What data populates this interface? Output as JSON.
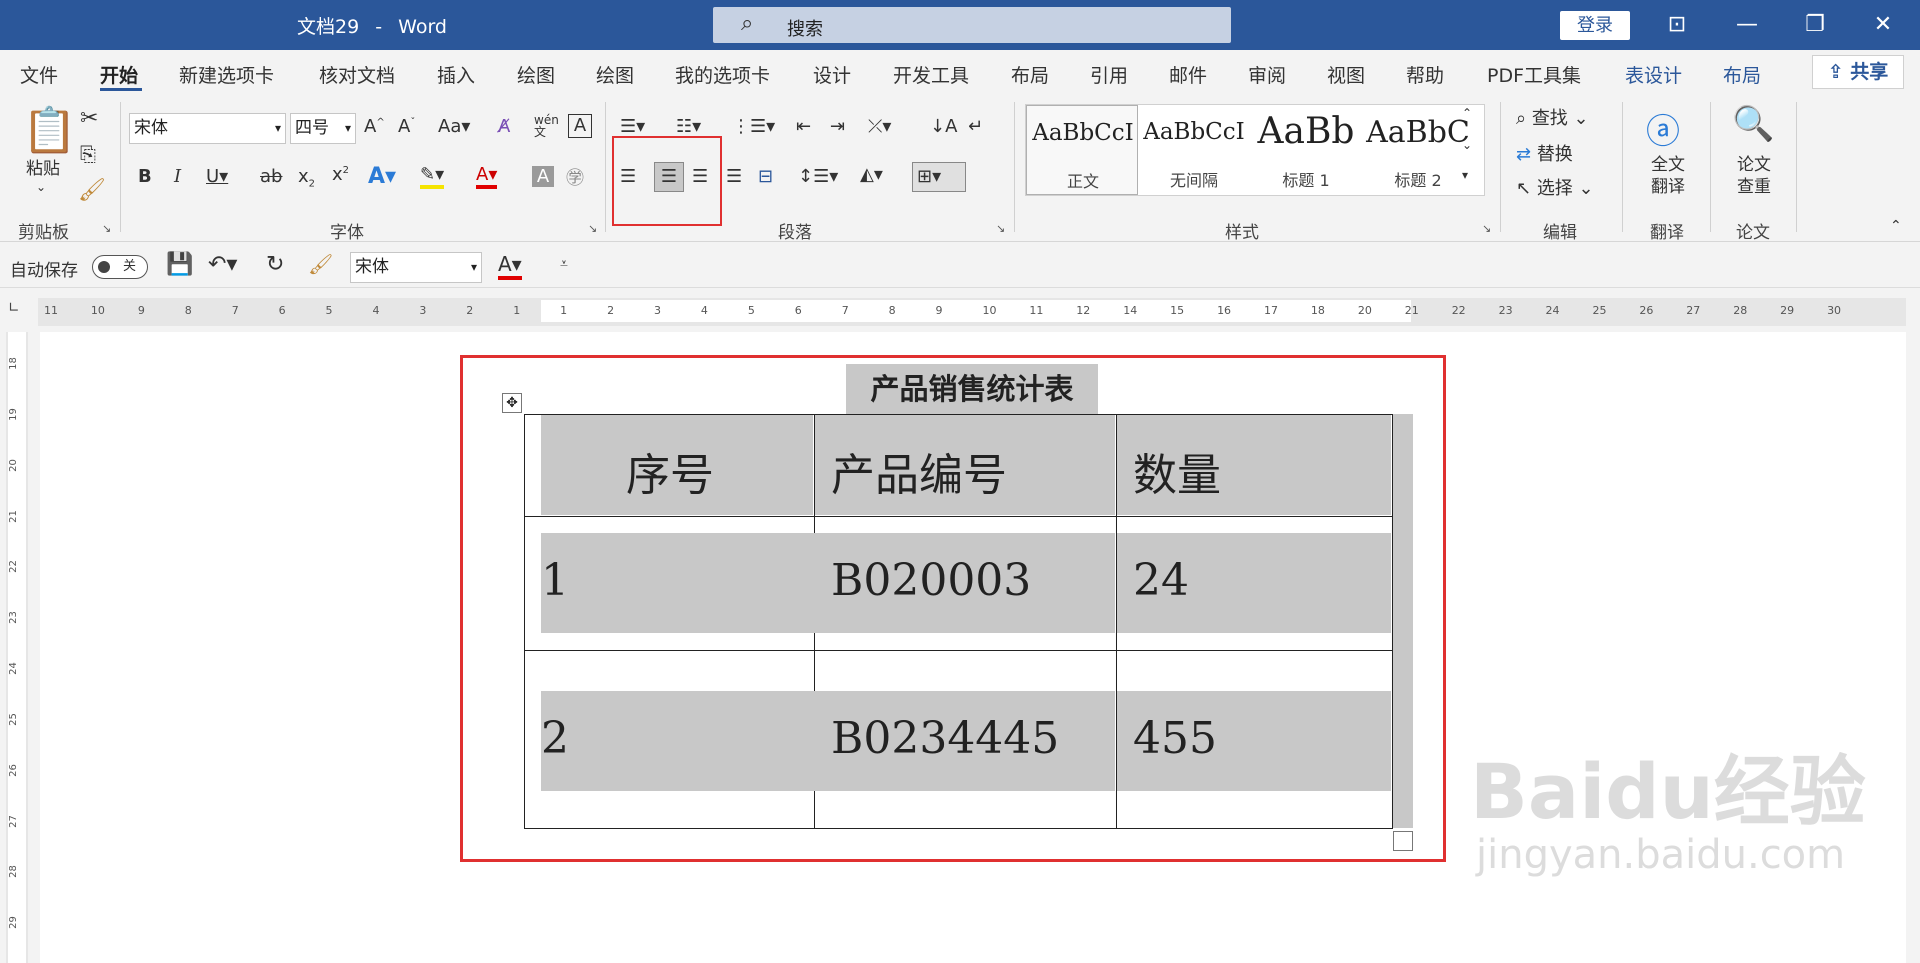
{
  "window": {
    "doc_name": "文档29",
    "app_name": "Word",
    "title_sep": "-",
    "search_label": "搜索",
    "login_label": "登录"
  },
  "tabs": [
    "文件",
    "开始",
    "新建选项卡",
    "核对文档",
    "插入",
    "绘图",
    "绘图",
    "我的选项卡",
    "设计",
    "开发工具",
    "布局",
    "引用",
    "邮件",
    "审阅",
    "视图",
    "帮助",
    "PDF工具集",
    "表设计",
    "布局"
  ],
  "active_tab": "开始",
  "share_label": "共享",
  "ribbon": {
    "groups": [
      "剪贴板",
      "字体",
      "段落",
      "样式",
      "编辑",
      "翻译",
      "论文"
    ],
    "clipboard": {
      "paste_label": "粘贴"
    },
    "font": {
      "family": "宋体",
      "size": "四号"
    },
    "styles": [
      {
        "sample": "AaBbCcI",
        "name": "正文"
      },
      {
        "sample": "AaBbCcI",
        "name": "无间隔"
      },
      {
        "sample": "AaBb",
        "name": "标题 1"
      },
      {
        "sample": "AaBbC",
        "name": "标题 2"
      }
    ],
    "editing": {
      "find": "查找",
      "replace": "替换",
      "select": "选择"
    },
    "translate": {
      "label_line1": "全文",
      "label_line2": "翻译"
    },
    "paper": {
      "label_line1": "论文",
      "label_line2": "查重"
    }
  },
  "qat": {
    "autosave_label": "自动保存",
    "autosave_state": "关",
    "font_family": "宋体"
  },
  "hruler_labels": [
    "11",
    "10",
    "9",
    "8",
    "7",
    "6",
    "5",
    "4",
    "3",
    "2",
    "1",
    "1",
    "2",
    "3",
    "4",
    "5",
    "6",
    "7",
    "8",
    "9",
    "10",
    "11",
    "12",
    "14",
    "15",
    "16",
    "17",
    "18",
    "20",
    "21",
    "22",
    "23",
    "24",
    "25",
    "26",
    "27",
    "28",
    "29",
    "30"
  ],
  "vruler_labels": [
    "18",
    "19",
    "20",
    "21",
    "22",
    "23",
    "24",
    "25",
    "26",
    "27",
    "28",
    "29"
  ],
  "document": {
    "table_title": "产品销售统计表",
    "headers": [
      "序号",
      "产品编号",
      "数量"
    ],
    "rows": [
      [
        "1",
        "B020003",
        "24"
      ],
      [
        "2",
        "B0234445",
        "455"
      ]
    ]
  },
  "watermark": {
    "brand": "Baidu经验",
    "url": "jingyan.baidu.com"
  },
  "colors": {
    "titlebar": "#2b579a",
    "highlight": "#c8c8c8",
    "annotation": "#e03030"
  }
}
